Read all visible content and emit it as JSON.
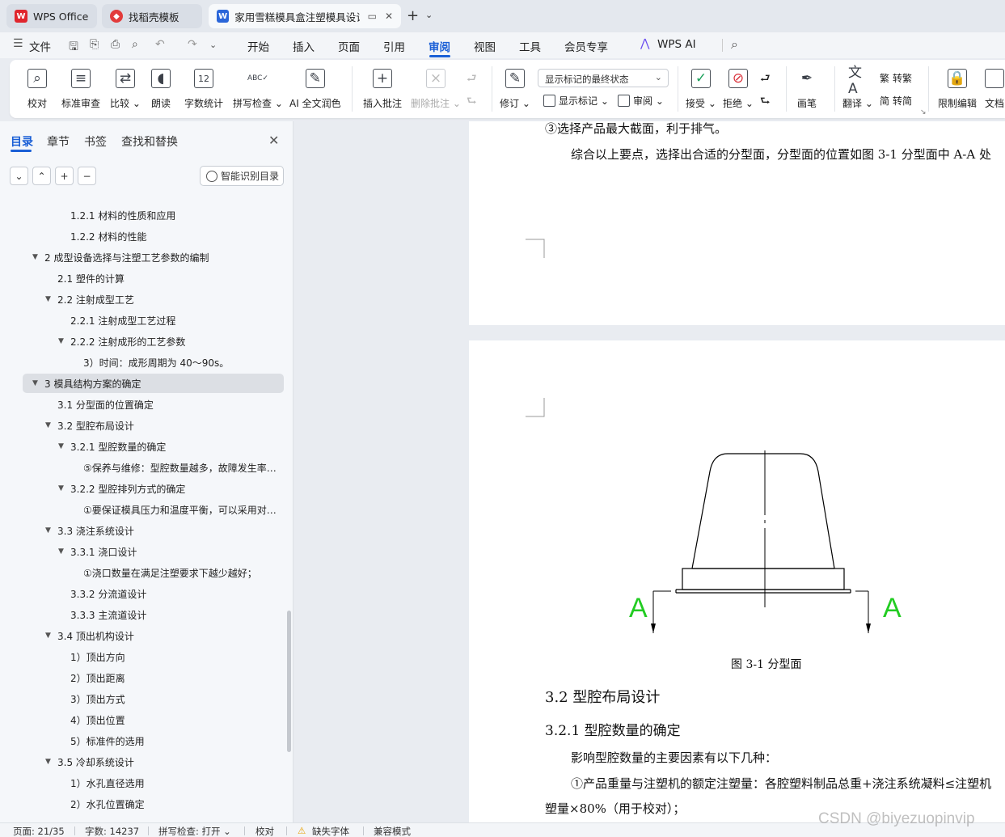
{
  "titlebar": {
    "tabs": [
      {
        "label": "WPS Office",
        "icon": "wps-logo-icon"
      },
      {
        "label": "找稻壳模板",
        "icon": "docer-icon"
      },
      {
        "label": "家用雪糕模具盒注塑模具设计",
        "icon": "word-doc-icon"
      }
    ]
  },
  "menubar": {
    "file": "文件",
    "items": [
      "开始",
      "插入",
      "页面",
      "引用",
      "审阅",
      "视图",
      "工具",
      "会员专享",
      "WPS AI"
    ],
    "active": "审阅"
  },
  "ribbon": {
    "proofread": "校对",
    "standard_review": "标准审查",
    "compare": "比较",
    "read_aloud": "朗读",
    "word_count": "字数统计",
    "spell_check": "拼写检查",
    "ai_polish": "AI 全文润色",
    "insert_comment": "插入批注",
    "delete_comment": "删除批注",
    "track_changes": "修订",
    "markup_state": "显示标记的最终状态",
    "show_markup": "显示标记",
    "review": "审阅",
    "accept": "接受",
    "reject": "拒绝",
    "pen": "画笔",
    "translate": "翻译",
    "to_traditional": "转繁",
    "to_simplified": "转简",
    "restrict_edit": "限制编辑",
    "doc_partial": "文档"
  },
  "nav": {
    "tabs": [
      "目录",
      "章节",
      "书签",
      "查找和替换"
    ],
    "smart_toc": "智能识别目录",
    "toc": [
      {
        "text": "1.2.1  材料的性质和应用",
        "level": 3,
        "toggle": false
      },
      {
        "text": "1.2.2 材料的性能",
        "level": 3,
        "toggle": false
      },
      {
        "text": "2  成型设备选择与注塑工艺参数的编制",
        "level": 1,
        "toggle": true
      },
      {
        "text": "2.1  塑件的计算",
        "level": 2,
        "toggle": false
      },
      {
        "text": "2.2  注射成型工艺",
        "level": 2,
        "toggle": true
      },
      {
        "text": "2.2.1  注射成型工艺过程",
        "level": 3,
        "toggle": false
      },
      {
        "text": "2.2.2  注射成形的工艺参数",
        "level": 3,
        "toggle": true
      },
      {
        "text": "3）时间：成形周期为 40～90s。",
        "level": 4,
        "toggle": false
      },
      {
        "text": "3  模具结构方案的确定",
        "level": 1,
        "toggle": true,
        "selected": true
      },
      {
        "text": "3.1  分型面的位置确定",
        "level": 2,
        "toggle": false
      },
      {
        "text": "3.2  型腔布局设计",
        "level": 2,
        "toggle": true
      },
      {
        "text": "3.2.1  型腔数量的确定",
        "level": 3,
        "toggle": true
      },
      {
        "text": "⑤保养与维修：型腔数量越多，故障发生率…",
        "level": 4,
        "toggle": false
      },
      {
        "text": "3.2.2  型腔排列方式的确定",
        "level": 3,
        "toggle": true
      },
      {
        "text": "①要保证模具压力和温度平衡，可以采用对…",
        "level": 4,
        "toggle": false
      },
      {
        "text": "3.3  浇注系统设计",
        "level": 2,
        "toggle": true
      },
      {
        "text": "3.3.1  浇口设计",
        "level": 3,
        "toggle": true
      },
      {
        "text": "①浇口数量在满足注塑要求下越少越好；",
        "level": 4,
        "toggle": false
      },
      {
        "text": "3.3.2  分流道设计",
        "level": 3,
        "toggle": false
      },
      {
        "text": "3.3.3  主流道设计",
        "level": 3,
        "toggle": false
      },
      {
        "text": "3.4  顶出机构设计",
        "level": 2,
        "toggle": true
      },
      {
        "text": "1）顶出方向",
        "level": 3,
        "toggle": false
      },
      {
        "text": "2）顶出距离",
        "level": 3,
        "toggle": false
      },
      {
        "text": "3）顶出方式",
        "level": 3,
        "toggle": false
      },
      {
        "text": "4）顶出位置",
        "level": 3,
        "toggle": false
      },
      {
        "text": "5）标准件的选用",
        "level": 3,
        "toggle": false
      },
      {
        "text": "3.5  冷却系统设计",
        "level": 2,
        "toggle": true
      },
      {
        "text": "1）水孔直径选用",
        "level": 3,
        "toggle": false
      },
      {
        "text": "2）水孔位置确定",
        "level": 3,
        "toggle": false
      }
    ]
  },
  "doc": {
    "line1": "③选择产品最大截面，利于排气。",
    "line2": "综合以上要点，选择出合适的分型面，分型面的位置如图 3-1 分型面中 A-A 处",
    "figure_label_left": "A",
    "figure_label_right": "A",
    "figure_caption": "图 3-1 分型面",
    "heading_32": "3.2  型腔布局设计",
    "heading_321": "3.2.1  型腔数量的确定",
    "para1": "影响型腔数量的主要因素有以下几种：",
    "para2": "①产品重量与注塑机的额定注塑量：各腔塑料制品总重+浇注系统凝料≤注塑机",
    "para3": "塑量×80%（用于校对）；"
  },
  "status": {
    "page": "页面: 21/35",
    "words": "字数: 14237",
    "spell": "拼写检查: 打开",
    "proof": "校对",
    "missing_font": "缺失字体",
    "compat": "兼容模式"
  },
  "watermark": "CSDN @biyezuopinvip",
  "colors": {
    "accent": "#1a5fd6",
    "wps_red": "#e0262d",
    "figure_green": "#22cc22"
  }
}
